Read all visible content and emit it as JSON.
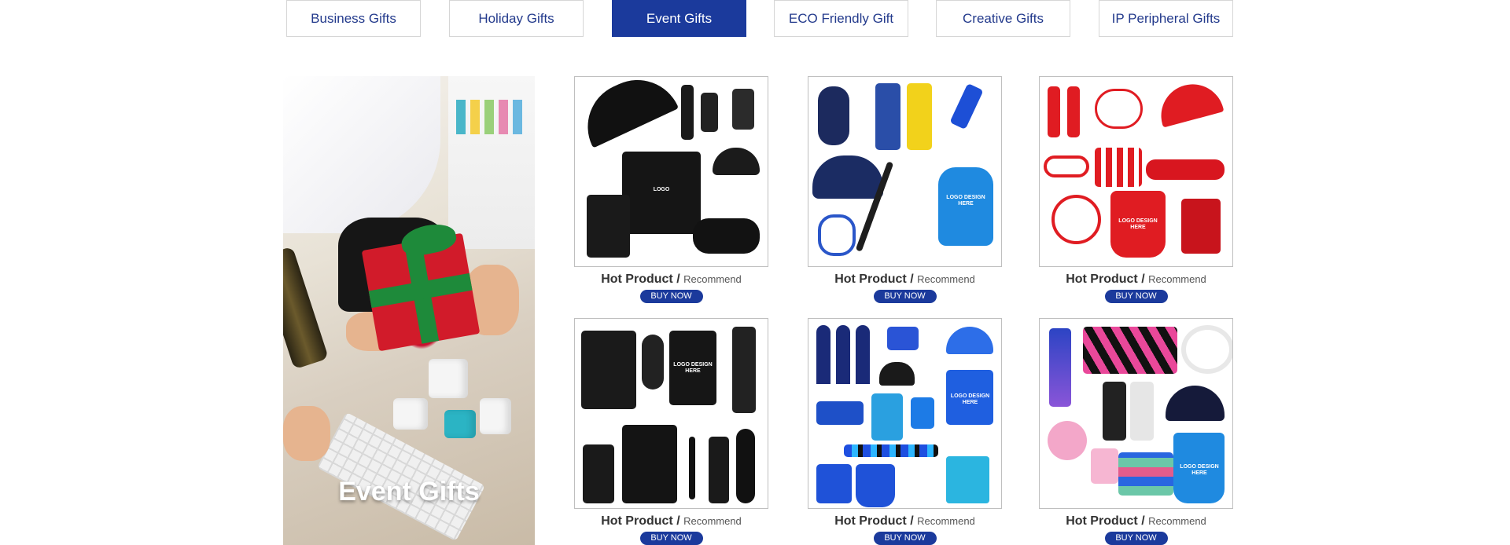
{
  "tabs": [
    {
      "label": "Business Gifts",
      "active": false
    },
    {
      "label": "Holiday Gifts",
      "active": false
    },
    {
      "label": "Event Gifts",
      "active": true
    },
    {
      "label": "ECO Friendly Gift",
      "active": false
    },
    {
      "label": "Creative Gifts",
      "active": false
    },
    {
      "label": "IP Peripheral Gifts",
      "active": false
    }
  ],
  "hero": {
    "label": "Event Gifts"
  },
  "products": [
    {
      "hot": "Hot Product /",
      "recommend": "Recommend",
      "button": "BUY NOW",
      "theme": "black"
    },
    {
      "hot": "Hot Product /",
      "recommend": "Recommend",
      "button": "BUY NOW",
      "theme": "blue"
    },
    {
      "hot": "Hot Product /",
      "recommend": "Recommend",
      "button": "BUY NOW",
      "theme": "red"
    },
    {
      "hot": "Hot Product /",
      "recommend": "Recommend",
      "button": "BUY NOW",
      "theme": "black"
    },
    {
      "hot": "Hot Product /",
      "recommend": "Recommend",
      "button": "BUY NOW",
      "theme": "blue"
    },
    {
      "hot": "Hot Product /",
      "recommend": "Recommend",
      "button": "BUY NOW",
      "theme": "mixed"
    }
  ],
  "logo_text": {
    "small": "LOGO",
    "full": "LOGO DESIGN HERE"
  },
  "colors": {
    "accent": "#1b3a9c",
    "tab_text": "#233a8c",
    "border": "#d6d6d6"
  }
}
